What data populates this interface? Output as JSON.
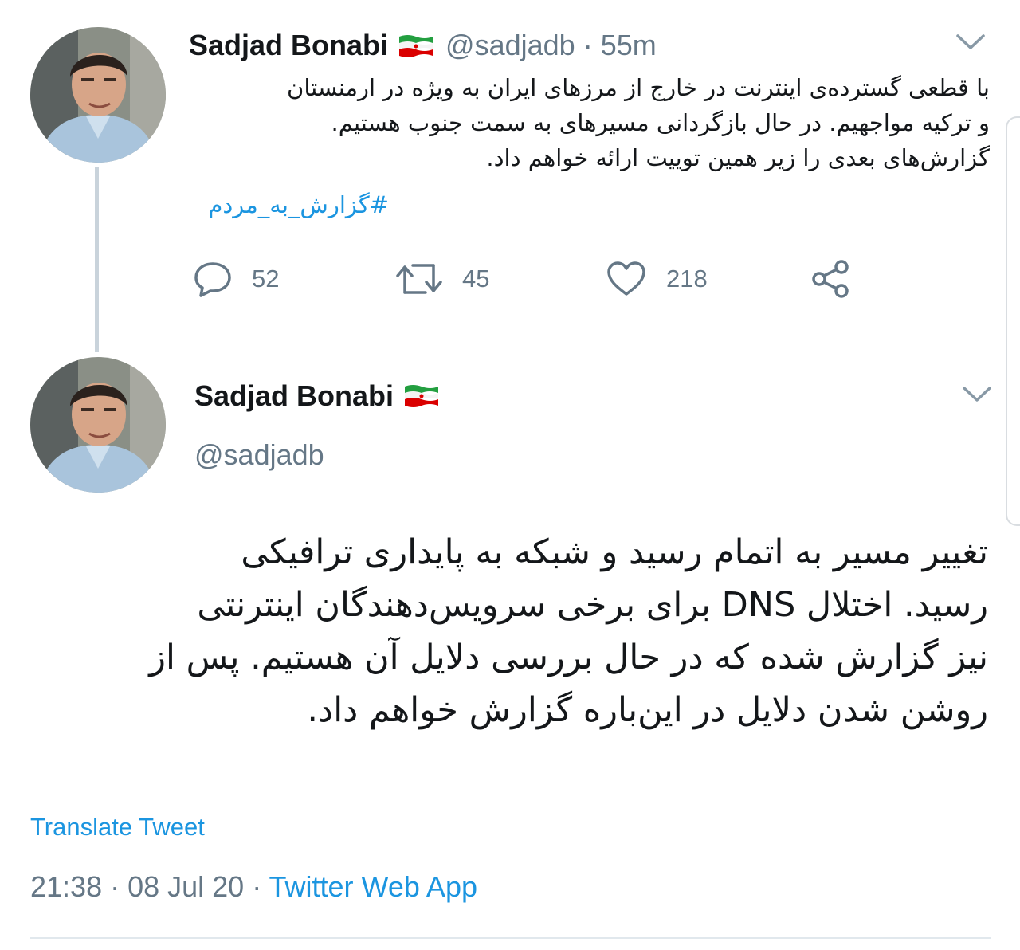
{
  "tweet1": {
    "author_name": "Sadjad Bonabi",
    "handle": "@sadjadb",
    "separator": "·",
    "time_ago": "55m",
    "text_lines": [
      "با قطعی گسترده‌ی اینترنت در خارج از مرزهای ایران به ویژه در ارمنستان",
      "و ترکیه مواجهیم. در حال بازگردانی مسیرهای به سمت جنوب هستیم.",
      "گزارش‌های بعدی را زیر همین توییت ارائه خواهم داد."
    ],
    "hashtag": "#گزارش_به_مردم",
    "actions": {
      "reply_count": "52",
      "retweet_count": "45",
      "like_count": "218"
    }
  },
  "tweet2": {
    "author_name": "Sadjad Bonabi",
    "handle": "@sadjadb",
    "text_lines": [
      "تغییر مسیر به اتمام رسید و شبکه به پایداری ترافیکی",
      "رسید. اختلال DNS برای برخی سرویس‌دهندگان اینترنتی",
      "نیز گزارش شده که در حال بررسی دلایل آن هستیم. پس از",
      "روشن شدن دلایل در این‌باره گزارش خواهم داد."
    ],
    "translate_label": "Translate Tweet",
    "timestamp": "21:38 · 08 Jul 20 · ",
    "source": "Twitter Web App"
  },
  "icons": {
    "reply": "reply-icon",
    "retweet": "retweet-icon",
    "like": "heart-icon",
    "share": "share-icon",
    "menu": "chevron-down-icon",
    "flag": "iran-flag-icon"
  },
  "colors": {
    "link_blue": "#1b95e0",
    "muted_gray": "#657786",
    "text": "#14171a",
    "thread_line": "#c9d3db"
  }
}
